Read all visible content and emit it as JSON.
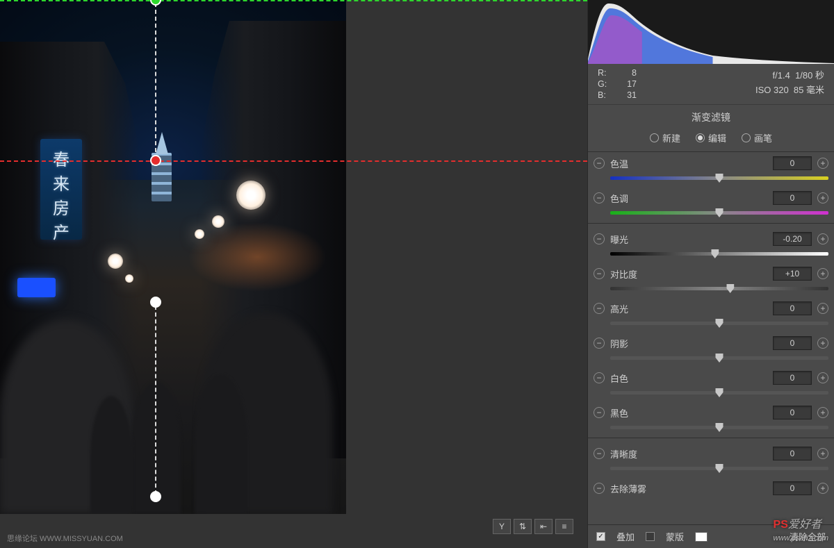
{
  "banner_chars": [
    "春",
    "来",
    "房",
    "产"
  ],
  "info": {
    "rgb": {
      "r_label": "R:",
      "r_val": "8",
      "g_label": "G:",
      "g_val": "17",
      "b_label": "B:",
      "b_val": "31"
    },
    "aperture": "f/1.4",
    "shutter": "1/80 秒",
    "iso": "ISO 320",
    "focal": "85 毫米"
  },
  "panel_title": "渐变滤镜",
  "modes": {
    "new": "新建",
    "edit": "编辑",
    "brush": "画笔",
    "selected": "edit"
  },
  "sliders": {
    "temp": {
      "label": "色温",
      "value": "0",
      "pos": 50,
      "track": "track-temp"
    },
    "tint": {
      "label": "色调",
      "value": "0",
      "pos": 50,
      "track": "track-tint"
    },
    "exposure": {
      "label": "曝光",
      "value": "-0.20",
      "pos": 48,
      "track": "track-exposure"
    },
    "contrast": {
      "label": "对比度",
      "value": "+10",
      "pos": 55,
      "track": "track-contrast"
    },
    "highlights": {
      "label": "高光",
      "value": "0",
      "pos": 50,
      "track": ""
    },
    "shadows": {
      "label": "阴影",
      "value": "0",
      "pos": 50,
      "track": ""
    },
    "whites": {
      "label": "白色",
      "value": "0",
      "pos": 50,
      "track": ""
    },
    "blacks": {
      "label": "黑色",
      "value": "0",
      "pos": 50,
      "track": ""
    },
    "clarity": {
      "label": "清晰度",
      "value": "0",
      "pos": 50,
      "track": ""
    },
    "dehaze": {
      "label": "去除薄雾",
      "value": "0",
      "pos": 50,
      "track": ""
    }
  },
  "footer": {
    "overlay": "叠加",
    "mask": "蒙版",
    "clear": "清除全部"
  },
  "toolbar_icons": {
    "level": "Y",
    "swap": "⇅",
    "before": "⇤",
    "settings": "≡"
  },
  "footer_note": "思缘论坛  WWW.MISSYUAN.COM",
  "watermark": {
    "brand": "PS",
    "text": "爱好者",
    "url": "www.psahz.com"
  },
  "glyphs": {
    "minus": "−",
    "plus": "+",
    "check": "✓"
  }
}
